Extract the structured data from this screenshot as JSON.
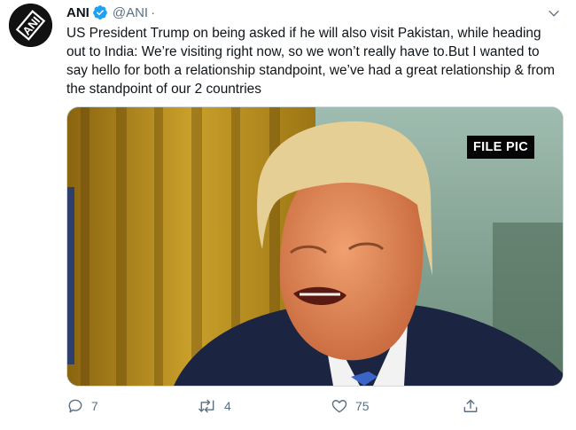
{
  "account": {
    "name": "ANI",
    "handle": "@ANI",
    "separator": "·",
    "avatar_logo_text": "ANI"
  },
  "tweet": {
    "text": "US President Trump on being asked if he will also visit Pakistan, while heading out to India: We’re visiting right now, so we won’t really have to.But I wanted to say hello for both a relationship standpoint, we’ve had a great relationship & from the standpoint of our 2 countries"
  },
  "media": {
    "overlay_label": "FILE PIC"
  },
  "actions": {
    "reply_count": "7",
    "retweet_count": "4",
    "like_count": "75"
  },
  "colors": {
    "verified": "#1da1f2",
    "muted": "#5b7083",
    "text": "#0f1419"
  },
  "icons": [
    "verified-badge-icon",
    "chevron-down-icon",
    "reply-icon",
    "retweet-icon",
    "like-icon",
    "share-icon"
  ]
}
